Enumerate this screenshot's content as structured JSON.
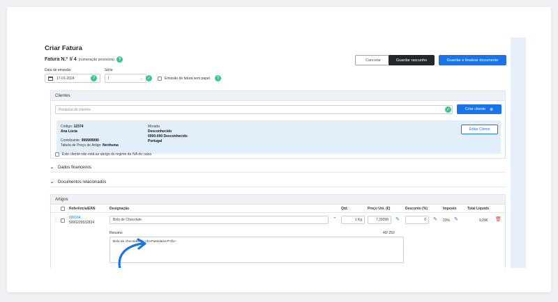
{
  "page": {
    "title": "Criar Fatura"
  },
  "invoice": {
    "label": "Fatura N.º",
    "number": "I/ 4",
    "note": "(numeração provisória)",
    "help": "?"
  },
  "actions": {
    "cancel": "Cancelar",
    "save_draft": "Guardar rascunho",
    "save_finalize": "Guardar e finalizar documento"
  },
  "form": {
    "date_label": "Data de emissão",
    "date_value": "17-01-2024",
    "series_label": "Série",
    "series_value": "I",
    "paperless_label": "Emissão de fatura sem papel"
  },
  "clients": {
    "header": "Clientes",
    "search_placeholder": "Pesquisa de clientes",
    "create_button": "Criar cliente",
    "code_label": "Código:",
    "code_value": "12374",
    "name": "Ana Lúcia",
    "taxpayer_label": "Contribuinte:",
    "taxpayer_value": "999999990",
    "price_table_label": "Tabela de Preço de Artigo:",
    "price_table_value": "Nenhuma",
    "address_label": "Morada",
    "address_line1": "Desconhecido",
    "address_line2": "0000-000 Desconhecido",
    "address_line3": "Portugal",
    "edit_button": "Editar Cliente",
    "vat_regime_label": "Este cliente não está ao abrigo do regime de IVA de caixa"
  },
  "sections": {
    "financial": "Dados financeiros",
    "related_docs": "Documentos relacionados"
  },
  "articles": {
    "header": "Artigos",
    "columns": {
      "ref": "Referência/EAN",
      "designation": "Designação",
      "qty": "Qtd.",
      "unit_price": "Preço Uni. (€)",
      "discount": "Desconto (%)",
      "tax": "Imposto",
      "total": "Total Líquido"
    },
    "rows": [
      {
        "ref": "000164",
        "ean": "5000229532824",
        "designation": "Bolo de Chocolate",
        "qty": "1 Kg",
        "unit_price": "7,39098",
        "discount": "0",
        "tax": "23%",
        "total": "9,09€"
      }
    ],
    "summary_label": "Resumo",
    "summary_count": "40/ 250",
    "summary_text": "Bolo de chocolate da <b>Pastelaria P</b>"
  }
}
